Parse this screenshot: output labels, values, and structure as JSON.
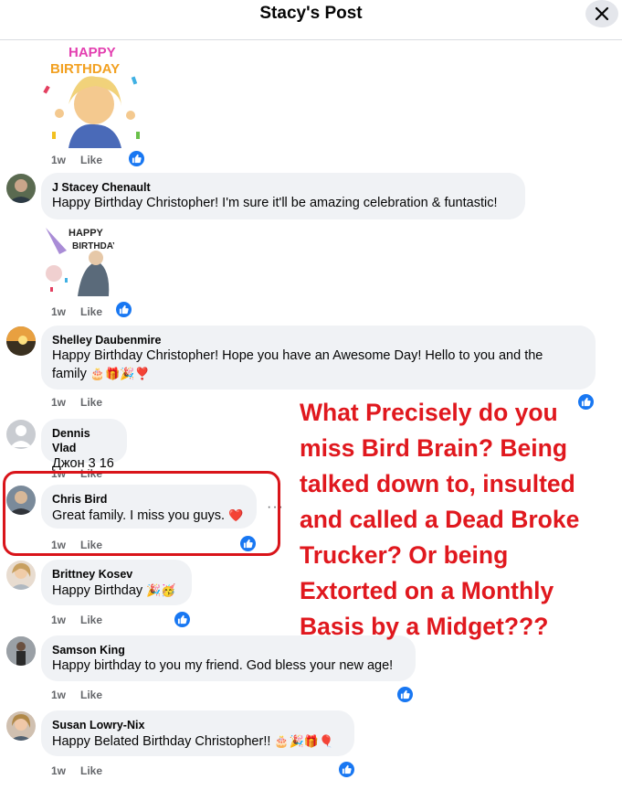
{
  "header": {
    "title": "Stacy's Post",
    "close_icon": "close-icon"
  },
  "labels": {
    "like": "Like"
  },
  "comments": [
    {
      "id": "c0",
      "time": "1w",
      "sticker": "Happy Birthday"
    },
    {
      "id": "c1",
      "name": "J Stacey Chenault",
      "text": "Happy Birthday Christopher! I'm sure it'll be amazing celebration & funtastic!",
      "time": "1w"
    },
    {
      "id": "c1s",
      "sticker": "HAPPY BIRTHDAY"
    },
    {
      "id": "c2",
      "name": "Shelley Daubenmire",
      "text_line1": "Happy Birthday Christopher! Hope you have an Awesome Day! Hello to you and the",
      "text_line2": "family",
      "emojis": "🎂🎁🎉❣️",
      "time": "1w"
    },
    {
      "id": "c3",
      "name": "Dennis Vlad",
      "text": "Джон 3 16",
      "time": "1w"
    },
    {
      "id": "c4",
      "name": "Chris Bird",
      "text": "Great family. I miss you guys.",
      "emoji": "❤️",
      "time": "1w",
      "more": "···"
    },
    {
      "id": "c5",
      "name": "Brittney Kosev",
      "text": "Happy Birthday",
      "emojis": "🎉🥳",
      "time": "1w"
    },
    {
      "id": "c6",
      "name": "Samson King",
      "text": "Happy birthday to you my friend. God bless your new age!",
      "time": "1w"
    },
    {
      "id": "c7",
      "name": "Susan Lowry-Nix",
      "text": "Happy Belated Birthday Christopher!!",
      "emojis": "🎂🎉🎁🎈",
      "time": "1w"
    }
  ],
  "annotation": {
    "lines": [
      "What Precisely do you",
      "miss Bird Brain? Being",
      "talked down to, insulted",
      "and called a Dead Broke",
      "Trucker? Or being",
      "Extorted on a Monthly",
      "Basis by a Midget???"
    ],
    "color": "#e0181e"
  },
  "colors": {
    "like_blue": "#1877f2",
    "bubble": "#f0f2f5",
    "meta": "#65676b",
    "highlight": "#d9141a"
  }
}
